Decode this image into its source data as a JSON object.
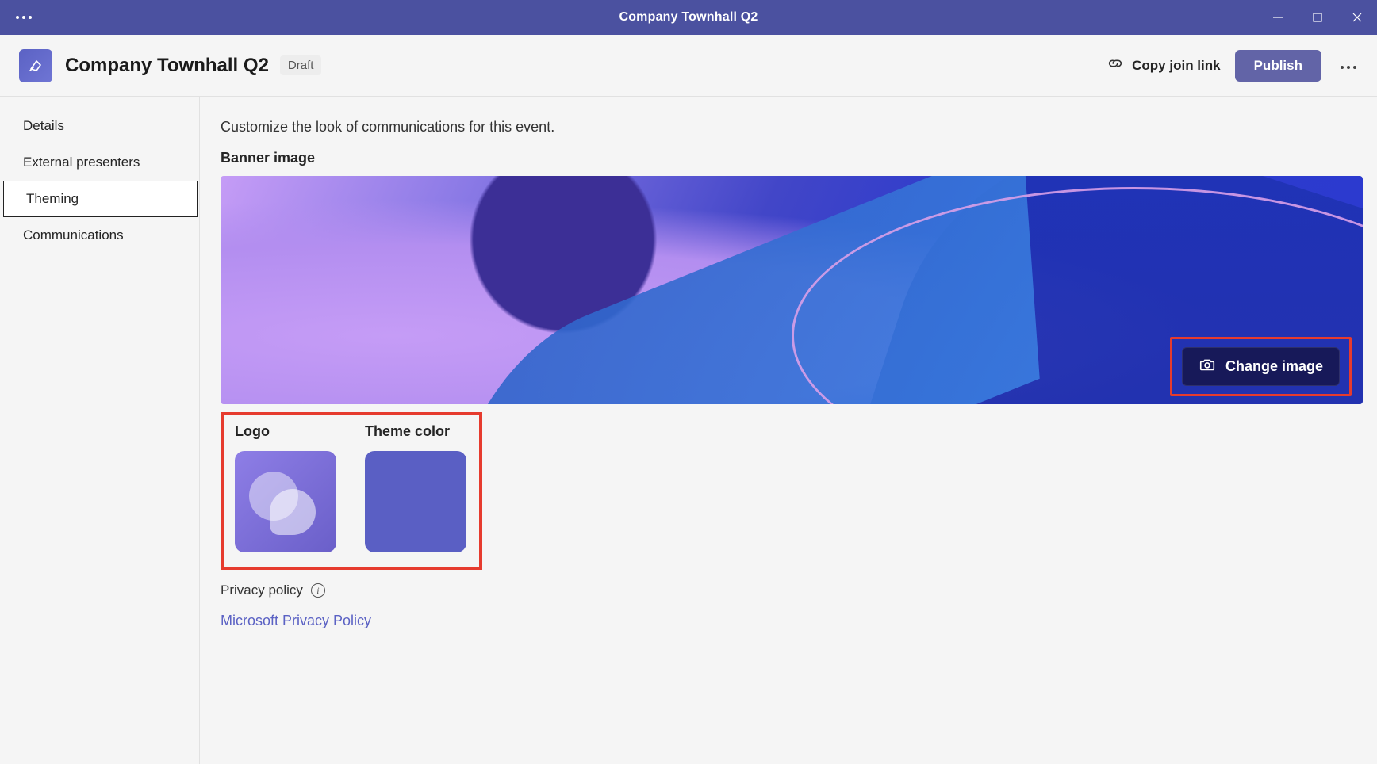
{
  "titlebar": {
    "title": "Company Townhall Q2"
  },
  "header": {
    "event_title": "Company Townhall Q2",
    "status_badge": "Draft",
    "copy_link_label": "Copy join link",
    "publish_label": "Publish"
  },
  "sidebar": {
    "items": [
      {
        "label": "Details",
        "active": false
      },
      {
        "label": "External presenters",
        "active": false
      },
      {
        "label": "Theming",
        "active": true
      },
      {
        "label": "Communications",
        "active": false
      }
    ]
  },
  "content": {
    "intro": "Customize the look of communications for this event.",
    "banner_label": "Banner image",
    "change_image_label": "Change image",
    "logo_label": "Logo",
    "theme_color_label": "Theme color",
    "theme_color_value": "#5a5fc4",
    "privacy_label": "Privacy policy",
    "privacy_link": "Microsoft Privacy Policy"
  }
}
